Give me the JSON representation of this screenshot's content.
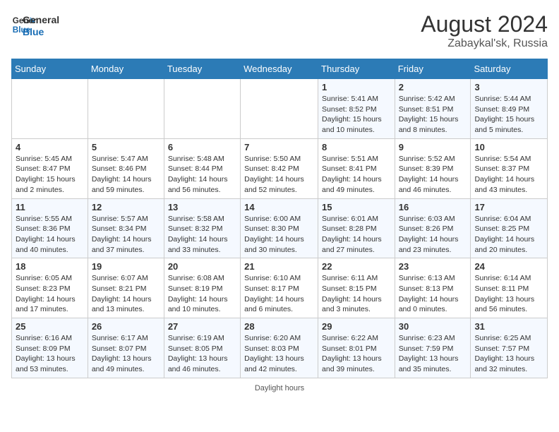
{
  "header": {
    "logo_line1": "General",
    "logo_line2": "Blue",
    "month_year": "August 2024",
    "location": "Zabaykal'sk, Russia"
  },
  "footer": {
    "note": "Daylight hours"
  },
  "days_of_week": [
    "Sunday",
    "Monday",
    "Tuesday",
    "Wednesday",
    "Thursday",
    "Friday",
    "Saturday"
  ],
  "weeks": [
    [
      {
        "day": "",
        "info": ""
      },
      {
        "day": "",
        "info": ""
      },
      {
        "day": "",
        "info": ""
      },
      {
        "day": "",
        "info": ""
      },
      {
        "day": "1",
        "info": "Sunrise: 5:41 AM\nSunset: 8:52 PM\nDaylight: 15 hours and 10 minutes."
      },
      {
        "day": "2",
        "info": "Sunrise: 5:42 AM\nSunset: 8:51 PM\nDaylight: 15 hours and 8 minutes."
      },
      {
        "day": "3",
        "info": "Sunrise: 5:44 AM\nSunset: 8:49 PM\nDaylight: 15 hours and 5 minutes."
      }
    ],
    [
      {
        "day": "4",
        "info": "Sunrise: 5:45 AM\nSunset: 8:47 PM\nDaylight: 15 hours and 2 minutes."
      },
      {
        "day": "5",
        "info": "Sunrise: 5:47 AM\nSunset: 8:46 PM\nDaylight: 14 hours and 59 minutes."
      },
      {
        "day": "6",
        "info": "Sunrise: 5:48 AM\nSunset: 8:44 PM\nDaylight: 14 hours and 56 minutes."
      },
      {
        "day": "7",
        "info": "Sunrise: 5:50 AM\nSunset: 8:42 PM\nDaylight: 14 hours and 52 minutes."
      },
      {
        "day": "8",
        "info": "Sunrise: 5:51 AM\nSunset: 8:41 PM\nDaylight: 14 hours and 49 minutes."
      },
      {
        "day": "9",
        "info": "Sunrise: 5:52 AM\nSunset: 8:39 PM\nDaylight: 14 hours and 46 minutes."
      },
      {
        "day": "10",
        "info": "Sunrise: 5:54 AM\nSunset: 8:37 PM\nDaylight: 14 hours and 43 minutes."
      }
    ],
    [
      {
        "day": "11",
        "info": "Sunrise: 5:55 AM\nSunset: 8:36 PM\nDaylight: 14 hours and 40 minutes."
      },
      {
        "day": "12",
        "info": "Sunrise: 5:57 AM\nSunset: 8:34 PM\nDaylight: 14 hours and 37 minutes."
      },
      {
        "day": "13",
        "info": "Sunrise: 5:58 AM\nSunset: 8:32 PM\nDaylight: 14 hours and 33 minutes."
      },
      {
        "day": "14",
        "info": "Sunrise: 6:00 AM\nSunset: 8:30 PM\nDaylight: 14 hours and 30 minutes."
      },
      {
        "day": "15",
        "info": "Sunrise: 6:01 AM\nSunset: 8:28 PM\nDaylight: 14 hours and 27 minutes."
      },
      {
        "day": "16",
        "info": "Sunrise: 6:03 AM\nSunset: 8:26 PM\nDaylight: 14 hours and 23 minutes."
      },
      {
        "day": "17",
        "info": "Sunrise: 6:04 AM\nSunset: 8:25 PM\nDaylight: 14 hours and 20 minutes."
      }
    ],
    [
      {
        "day": "18",
        "info": "Sunrise: 6:05 AM\nSunset: 8:23 PM\nDaylight: 14 hours and 17 minutes."
      },
      {
        "day": "19",
        "info": "Sunrise: 6:07 AM\nSunset: 8:21 PM\nDaylight: 14 hours and 13 minutes."
      },
      {
        "day": "20",
        "info": "Sunrise: 6:08 AM\nSunset: 8:19 PM\nDaylight: 14 hours and 10 minutes."
      },
      {
        "day": "21",
        "info": "Sunrise: 6:10 AM\nSunset: 8:17 PM\nDaylight: 14 hours and 6 minutes."
      },
      {
        "day": "22",
        "info": "Sunrise: 6:11 AM\nSunset: 8:15 PM\nDaylight: 14 hours and 3 minutes."
      },
      {
        "day": "23",
        "info": "Sunrise: 6:13 AM\nSunset: 8:13 PM\nDaylight: 14 hours and 0 minutes."
      },
      {
        "day": "24",
        "info": "Sunrise: 6:14 AM\nSunset: 8:11 PM\nDaylight: 13 hours and 56 minutes."
      }
    ],
    [
      {
        "day": "25",
        "info": "Sunrise: 6:16 AM\nSunset: 8:09 PM\nDaylight: 13 hours and 53 minutes."
      },
      {
        "day": "26",
        "info": "Sunrise: 6:17 AM\nSunset: 8:07 PM\nDaylight: 13 hours and 49 minutes."
      },
      {
        "day": "27",
        "info": "Sunrise: 6:19 AM\nSunset: 8:05 PM\nDaylight: 13 hours and 46 minutes."
      },
      {
        "day": "28",
        "info": "Sunrise: 6:20 AM\nSunset: 8:03 PM\nDaylight: 13 hours and 42 minutes."
      },
      {
        "day": "29",
        "info": "Sunrise: 6:22 AM\nSunset: 8:01 PM\nDaylight: 13 hours and 39 minutes."
      },
      {
        "day": "30",
        "info": "Sunrise: 6:23 AM\nSunset: 7:59 PM\nDaylight: 13 hours and 35 minutes."
      },
      {
        "day": "31",
        "info": "Sunrise: 6:25 AM\nSunset: 7:57 PM\nDaylight: 13 hours and 32 minutes."
      }
    ]
  ]
}
